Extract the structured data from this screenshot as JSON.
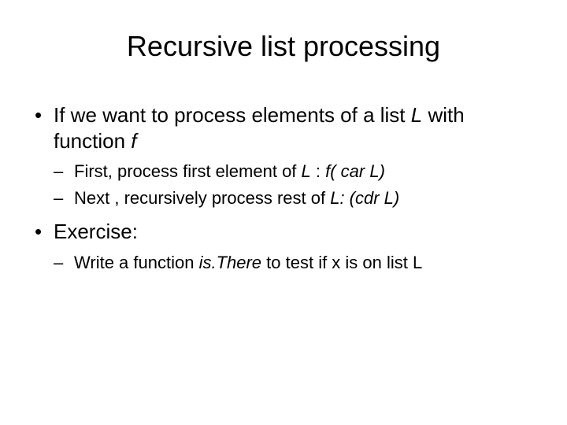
{
  "title": "Recursive list processing",
  "b1_pre": "If we want to process elements of a list ",
  "b1_L": "L",
  "b1_mid": " with function ",
  "b1_f": "f",
  "s1_pre": "First, process first element of ",
  "s1_L": "L",
  "s1_mid": " : ",
  "s1_expr": "f( car L)",
  "s2_pre": "Next , recursively process rest of ",
  "s2_L": "L: (cdr L)",
  "b2": "Exercise:",
  "s3_pre": "Write a function ",
  "s3_fn": "is.There",
  "s3_post": " to test if x is on list L"
}
